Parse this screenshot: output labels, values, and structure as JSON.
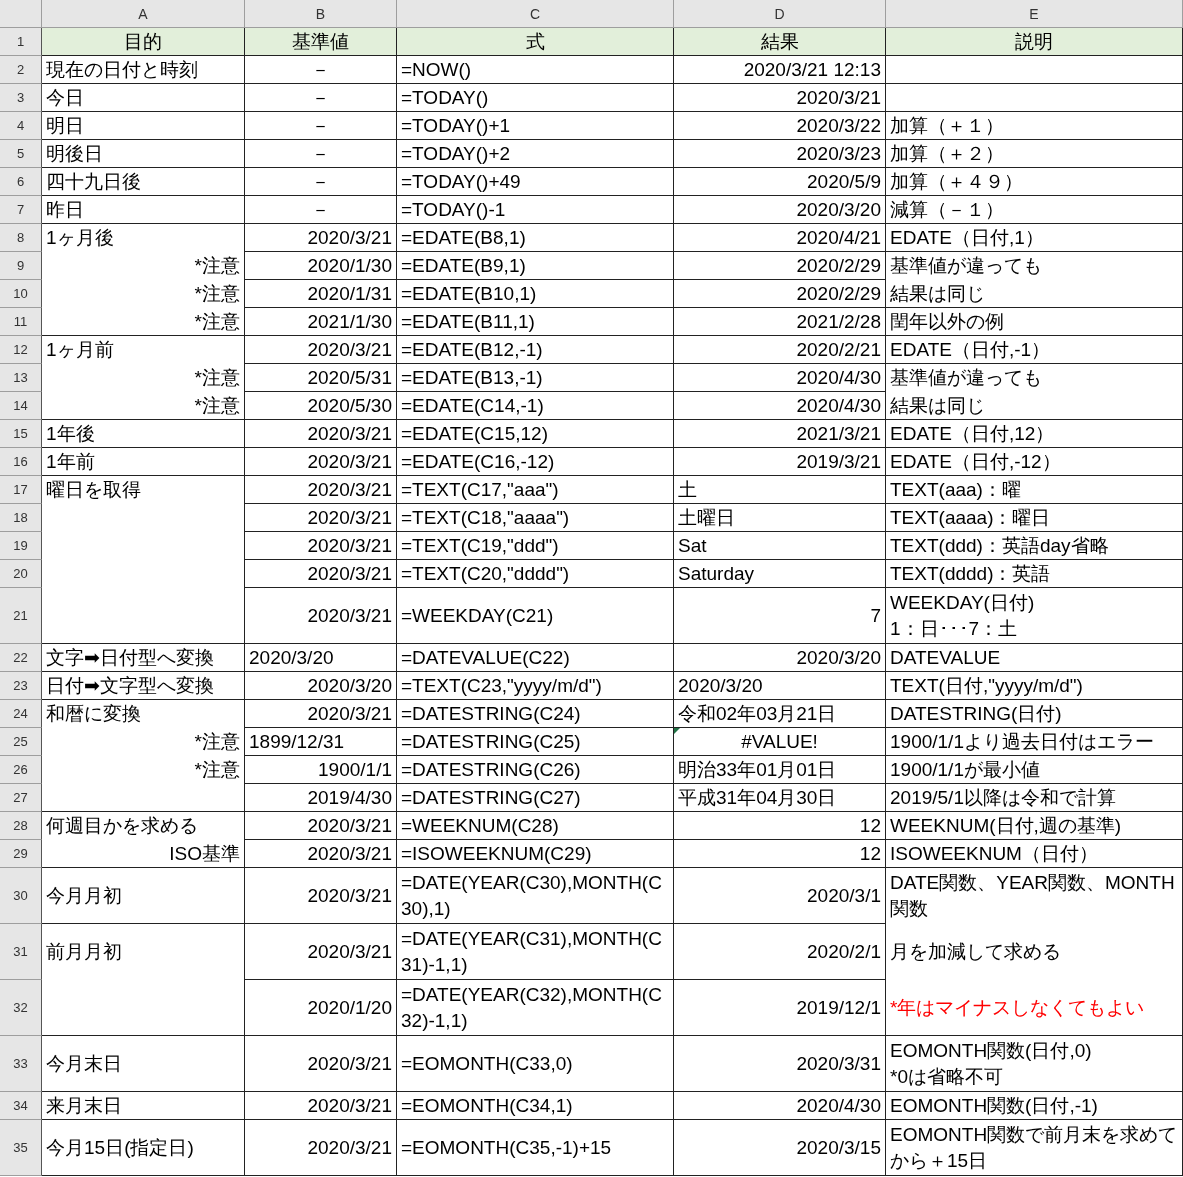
{
  "column_letters": [
    "A",
    "B",
    "C",
    "D",
    "E"
  ],
  "rows": [
    {
      "label": "1",
      "kind": "single"
    },
    {
      "label": "2",
      "kind": "single"
    },
    {
      "label": "3",
      "kind": "single"
    },
    {
      "label": "4",
      "kind": "single"
    },
    {
      "label": "5",
      "kind": "single"
    },
    {
      "label": "6",
      "kind": "single"
    },
    {
      "label": "7",
      "kind": "single"
    },
    {
      "label": "8",
      "kind": "single"
    },
    {
      "label": "9",
      "kind": "single"
    },
    {
      "label": "10",
      "kind": "single"
    },
    {
      "label": "11",
      "kind": "single"
    },
    {
      "label": "12",
      "kind": "single"
    },
    {
      "label": "13",
      "kind": "single"
    },
    {
      "label": "14",
      "kind": "single"
    },
    {
      "label": "15",
      "kind": "single"
    },
    {
      "label": "16",
      "kind": "single"
    },
    {
      "label": "17",
      "kind": "single"
    },
    {
      "label": "18",
      "kind": "single"
    },
    {
      "label": "19",
      "kind": "single"
    },
    {
      "label": "20",
      "kind": "single"
    },
    {
      "label": "21",
      "kind": "double"
    },
    {
      "label": "22",
      "kind": "single"
    },
    {
      "label": "23",
      "kind": "single"
    },
    {
      "label": "24",
      "kind": "single"
    },
    {
      "label": "25",
      "kind": "single"
    },
    {
      "label": "26",
      "kind": "single"
    },
    {
      "label": "27",
      "kind": "single"
    },
    {
      "label": "28",
      "kind": "single"
    },
    {
      "label": "29",
      "kind": "single"
    },
    {
      "label": "30",
      "kind": "double"
    },
    {
      "label": "31",
      "kind": "double"
    },
    {
      "label": "32",
      "kind": "double"
    },
    {
      "label": "33",
      "kind": "double"
    },
    {
      "label": "34",
      "kind": "single"
    },
    {
      "label": "35",
      "kind": "double"
    }
  ],
  "columns": [
    {
      "blocks": [
        {
          "kind": "header",
          "lines": [
            {
              "text": "目的",
              "kind": "center"
            }
          ]
        },
        {
          "lines": [
            {
              "text": "現在の日付と時刻",
              "kind": "left"
            }
          ]
        },
        {
          "lines": [
            {
              "text": "今日",
              "kind": "left"
            }
          ]
        },
        {
          "lines": [
            {
              "text": "明日",
              "kind": "left"
            }
          ]
        },
        {
          "lines": [
            {
              "text": "明後日",
              "kind": "left"
            }
          ]
        },
        {
          "lines": [
            {
              "text": "四十九日後",
              "kind": "left"
            }
          ]
        },
        {
          "lines": [
            {
              "text": "昨日",
              "kind": "left"
            }
          ]
        },
        {
          "lines": [
            {
              "text": "1ヶ月後",
              "kind": "left"
            },
            {
              "text": "*注意",
              "kind": "right"
            },
            {
              "text": "*注意",
              "kind": "right"
            },
            {
              "text": "*注意",
              "kind": "right"
            }
          ]
        },
        {
          "lines": [
            {
              "text": "1ヶ月前",
              "kind": "left"
            },
            {
              "text": "*注意",
              "kind": "right"
            },
            {
              "text": "*注意",
              "kind": "right"
            }
          ]
        },
        {
          "lines": [
            {
              "text": "1年後",
              "kind": "left"
            }
          ]
        },
        {
          "lines": [
            {
              "text": "1年前",
              "kind": "left"
            }
          ]
        },
        {
          "lines": [
            {
              "text": "曜日を取得",
              "kind": "left"
            },
            {
              "kind": "blank"
            },
            {
              "kind": "blank"
            },
            {
              "kind": "blank"
            },
            {
              "kind": "blank"
            }
          ]
        },
        {
          "lines": [
            {
              "text": "文字➡日付型へ変換",
              "kind": "left"
            }
          ]
        },
        {
          "lines": [
            {
              "text": "日付➡文字型へ変換",
              "kind": "left"
            }
          ]
        },
        {
          "lines": [
            {
              "text": "和暦に変換",
              "kind": "left"
            },
            {
              "text": "*注意",
              "kind": "right"
            },
            {
              "text": "*注意",
              "kind": "right"
            },
            {
              "kind": "blank"
            }
          ]
        },
        {
          "lines": [
            {
              "text": "何週目かを求める",
              "kind": "left"
            },
            {
              "text": "ISO基準",
              "kind": "right"
            }
          ]
        },
        {
          "lines": [
            {
              "text": "今月月初",
              "kind": "left"
            }
          ]
        },
        {
          "lines": [
            {
              "text": "前月月初",
              "kind": "left"
            },
            {
              "kind": "blank"
            }
          ]
        },
        {
          "lines": [
            {
              "text": "今月末日",
              "kind": "left"
            }
          ]
        },
        {
          "lines": [
            {
              "text": "来月末日",
              "kind": "left"
            }
          ]
        },
        {
          "lines": [
            {
              "text": "今月15日(指定日)",
              "kind": "left"
            }
          ]
        }
      ]
    },
    {
      "blocks": [
        {
          "kind": "header",
          "lines": [
            {
              "text": "基準値",
              "kind": "center"
            }
          ]
        },
        {
          "lines": [
            {
              "text": "－",
              "kind": "center"
            }
          ]
        },
        {
          "lines": [
            {
              "text": "－",
              "kind": "center"
            }
          ]
        },
        {
          "lines": [
            {
              "text": "－",
              "kind": "center"
            }
          ]
        },
        {
          "lines": [
            {
              "text": "－",
              "kind": "center"
            }
          ]
        },
        {
          "lines": [
            {
              "text": "－",
              "kind": "center"
            }
          ]
        },
        {
          "lines": [
            {
              "text": "－",
              "kind": "center"
            }
          ]
        },
        {
          "lines": [
            {
              "text": "2020/3/21",
              "kind": "right"
            }
          ]
        },
        {
          "lines": [
            {
              "text": "2020/1/30",
              "kind": "right"
            }
          ]
        },
        {
          "lines": [
            {
              "text": "2020/1/31",
              "kind": "right"
            }
          ]
        },
        {
          "lines": [
            {
              "text": "2021/1/30",
              "kind": "right"
            }
          ]
        },
        {
          "lines": [
            {
              "text": "2020/3/21",
              "kind": "right"
            }
          ]
        },
        {
          "lines": [
            {
              "text": "2020/5/31",
              "kind": "right"
            }
          ]
        },
        {
          "lines": [
            {
              "text": "2020/5/30",
              "kind": "right"
            }
          ]
        },
        {
          "lines": [
            {
              "text": "2020/3/21",
              "kind": "right"
            }
          ]
        },
        {
          "lines": [
            {
              "text": "2020/3/21",
              "kind": "right"
            }
          ]
        },
        {
          "lines": [
            {
              "text": "2020/3/21",
              "kind": "right"
            }
          ]
        },
        {
          "lines": [
            {
              "text": "2020/3/21",
              "kind": "right"
            }
          ]
        },
        {
          "lines": [
            {
              "text": "2020/3/21",
              "kind": "right"
            }
          ]
        },
        {
          "lines": [
            {
              "text": "2020/3/21",
              "kind": "right"
            }
          ]
        },
        {
          "lines": [
            {
              "text": "2020/3/21",
              "kind": "right"
            }
          ]
        },
        {
          "lines": [
            {
              "text": "2020/3/20",
              "kind": "left"
            }
          ]
        },
        {
          "lines": [
            {
              "text": "2020/3/20",
              "kind": "right"
            }
          ]
        },
        {
          "lines": [
            {
              "text": "2020/3/21",
              "kind": "right"
            }
          ]
        },
        {
          "lines": [
            {
              "text": "1899/12/31",
              "kind": "left"
            }
          ]
        },
        {
          "lines": [
            {
              "text": "1900/1/1",
              "kind": "right"
            }
          ]
        },
        {
          "lines": [
            {
              "text": "2019/4/30",
              "kind": "right"
            }
          ]
        },
        {
          "lines": [
            {
              "text": "2020/3/21",
              "kind": "right"
            }
          ]
        },
        {
          "lines": [
            {
              "text": "2020/3/21",
              "kind": "right"
            }
          ]
        },
        {
          "lines": [
            {
              "text": "2020/3/21",
              "kind": "right"
            }
          ]
        },
        {
          "lines": [
            {
              "text": "2020/3/21",
              "kind": "right"
            }
          ]
        },
        {
          "lines": [
            {
              "text": "2020/1/20",
              "kind": "right"
            }
          ]
        },
        {
          "lines": [
            {
              "text": "2020/3/21",
              "kind": "right"
            }
          ]
        },
        {
          "lines": [
            {
              "text": "2020/3/21",
              "kind": "right"
            }
          ]
        },
        {
          "lines": [
            {
              "text": "2020/3/21",
              "kind": "right"
            }
          ]
        }
      ]
    },
    {
      "blocks": [
        {
          "kind": "header",
          "lines": [
            {
              "text": "式",
              "kind": "center"
            }
          ]
        },
        {
          "lines": [
            {
              "text": "=NOW()",
              "kind": "left"
            }
          ]
        },
        {
          "lines": [
            {
              "text": "=TODAY()",
              "kind": "left"
            }
          ]
        },
        {
          "lines": [
            {
              "text": "=TODAY()+1",
              "kind": "left"
            }
          ]
        },
        {
          "lines": [
            {
              "text": "=TODAY()+2",
              "kind": "left"
            }
          ]
        },
        {
          "lines": [
            {
              "text": "=TODAY()+49",
              "kind": "left"
            }
          ]
        },
        {
          "lines": [
            {
              "text": "=TODAY()-1",
              "kind": "left"
            }
          ]
        },
        {
          "lines": [
            {
              "text": "=EDATE(B8,1)",
              "kind": "left"
            }
          ]
        },
        {
          "lines": [
            {
              "text": "=EDATE(B9,1)",
              "kind": "left"
            }
          ]
        },
        {
          "lines": [
            {
              "text": "=EDATE(B10,1)",
              "kind": "left"
            }
          ]
        },
        {
          "lines": [
            {
              "text": "=EDATE(B11,1)",
              "kind": "left"
            }
          ]
        },
        {
          "lines": [
            {
              "text": "=EDATE(B12,-1)",
              "kind": "left"
            }
          ]
        },
        {
          "lines": [
            {
              "text": "=EDATE(B13,-1)",
              "kind": "left"
            }
          ]
        },
        {
          "lines": [
            {
              "text": "=EDATE(C14,-1)",
              "kind": "left"
            }
          ]
        },
        {
          "lines": [
            {
              "text": "=EDATE(C15,12)",
              "kind": "left"
            }
          ]
        },
        {
          "lines": [
            {
              "text": "=EDATE(C16,-12)",
              "kind": "left"
            }
          ]
        },
        {
          "lines": [
            {
              "text": "=TEXT(C17,\"aaa\")",
              "kind": "left"
            }
          ]
        },
        {
          "lines": [
            {
              "text": "=TEXT(C18,\"aaaa\")",
              "kind": "left"
            }
          ]
        },
        {
          "lines": [
            {
              "text": "=TEXT(C19,\"ddd\")",
              "kind": "left"
            }
          ]
        },
        {
          "lines": [
            {
              "text": "=TEXT(C20,\"dddd\")",
              "kind": "left"
            }
          ]
        },
        {
          "lines": [
            {
              "text": "=WEEKDAY(C21)",
              "kind": "left"
            }
          ]
        },
        {
          "lines": [
            {
              "text": "=DATEVALUE(C22)",
              "kind": "left"
            }
          ]
        },
        {
          "lines": [
            {
              "text": "=TEXT(C23,\"yyyy/m/d\")",
              "kind": "left"
            }
          ]
        },
        {
          "lines": [
            {
              "text": "=DATESTRING(C24)",
              "kind": "left"
            }
          ]
        },
        {
          "lines": [
            {
              "text": "=DATESTRING(C25)",
              "kind": "left"
            }
          ]
        },
        {
          "lines": [
            {
              "text": "=DATESTRING(C26)",
              "kind": "left"
            }
          ]
        },
        {
          "lines": [
            {
              "text": "=DATESTRING(C27)",
              "kind": "left"
            }
          ]
        },
        {
          "lines": [
            {
              "text": "=WEEKNUM(C28)",
              "kind": "left"
            }
          ]
        },
        {
          "lines": [
            {
              "text": "=ISOWEEKNUM(C29)",
              "kind": "left"
            }
          ]
        },
        {
          "lines": [
            {
              "text": "=DATE(YEAR(C30),MONTH(C30),1)",
              "kind": "left"
            }
          ]
        },
        {
          "lines": [
            {
              "text": "=DATE(YEAR(C31),MONTH(C31)-1,1)",
              "kind": "left"
            }
          ]
        },
        {
          "lines": [
            {
              "text": "=DATE(YEAR(C32),MONTH(C32)-1,1)",
              "kind": "left"
            }
          ]
        },
        {
          "lines": [
            {
              "text": "=EOMONTH(C33,0)",
              "kind": "left"
            }
          ]
        },
        {
          "lines": [
            {
              "text": "=EOMONTH(C34,1)",
              "kind": "left"
            }
          ]
        },
        {
          "lines": [
            {
              "text": "=EOMONTH(C35,-1)+15",
              "kind": "left"
            }
          ]
        }
      ]
    },
    {
      "blocks": [
        {
          "kind": "header",
          "lines": [
            {
              "text": "結果",
              "kind": "center"
            }
          ]
        },
        {
          "lines": [
            {
              "text": "2020/3/21 12:13",
              "kind": "right"
            }
          ]
        },
        {
          "lines": [
            {
              "text": "2020/3/21",
              "kind": "right"
            }
          ]
        },
        {
          "lines": [
            {
              "text": "2020/3/22",
              "kind": "right"
            }
          ]
        },
        {
          "lines": [
            {
              "text": "2020/3/23",
              "kind": "right"
            }
          ]
        },
        {
          "lines": [
            {
              "text": "2020/5/9",
              "kind": "right"
            }
          ]
        },
        {
          "lines": [
            {
              "text": "2020/3/20",
              "kind": "right"
            }
          ]
        },
        {
          "lines": [
            {
              "text": "2020/4/21",
              "kind": "right"
            }
          ]
        },
        {
          "lines": [
            {
              "text": "2020/2/29",
              "kind": "right"
            }
          ]
        },
        {
          "lines": [
            {
              "text": "2020/2/29",
              "kind": "right"
            }
          ]
        },
        {
          "lines": [
            {
              "text": "2021/2/28",
              "kind": "right"
            }
          ]
        },
        {
          "lines": [
            {
              "text": "2020/2/21",
              "kind": "right"
            }
          ]
        },
        {
          "lines": [
            {
              "text": "2020/4/30",
              "kind": "right"
            }
          ]
        },
        {
          "lines": [
            {
              "text": "2020/4/30",
              "kind": "right"
            }
          ]
        },
        {
          "lines": [
            {
              "text": "2021/3/21",
              "kind": "right"
            }
          ]
        },
        {
          "lines": [
            {
              "text": "2019/3/21",
              "kind": "right"
            }
          ]
        },
        {
          "lines": [
            {
              "text": "土",
              "kind": "left"
            }
          ]
        },
        {
          "lines": [
            {
              "text": "土曜日",
              "kind": "left"
            }
          ]
        },
        {
          "lines": [
            {
              "text": "Sat",
              "kind": "left"
            }
          ]
        },
        {
          "lines": [
            {
              "text": "Saturday",
              "kind": "left"
            }
          ]
        },
        {
          "lines": [
            {
              "text": "7",
              "kind": "right"
            }
          ]
        },
        {
          "lines": [
            {
              "text": "2020/3/20",
              "kind": "right"
            }
          ]
        },
        {
          "lines": [
            {
              "text": "2020/3/20",
              "kind": "left"
            }
          ]
        },
        {
          "lines": [
            {
              "text": "令和02年03月21日",
              "kind": "left"
            }
          ]
        },
        {
          "lines": [
            {
              "text": "#VALUE!",
              "kind": "center",
              "error_flag": true
            }
          ]
        },
        {
          "lines": [
            {
              "text": "明治33年01月01日",
              "kind": "left"
            }
          ]
        },
        {
          "lines": [
            {
              "text": "平成31年04月30日",
              "kind": "left"
            }
          ]
        },
        {
          "lines": [
            {
              "text": "12",
              "kind": "right"
            }
          ]
        },
        {
          "lines": [
            {
              "text": "12",
              "kind": "right"
            }
          ]
        },
        {
          "lines": [
            {
              "text": "2020/3/1",
              "kind": "right"
            }
          ]
        },
        {
          "lines": [
            {
              "text": "2020/2/1",
              "kind": "right"
            }
          ]
        },
        {
          "lines": [
            {
              "text": "2019/12/1",
              "kind": "right"
            }
          ]
        },
        {
          "lines": [
            {
              "text": "2020/3/31",
              "kind": "right"
            }
          ]
        },
        {
          "lines": [
            {
              "text": "2020/4/30",
              "kind": "right"
            }
          ]
        },
        {
          "lines": [
            {
              "text": "2020/3/15",
              "kind": "right"
            }
          ]
        }
      ]
    },
    {
      "blocks": [
        {
          "kind": "header",
          "lines": [
            {
              "text": "説明",
              "kind": "center"
            }
          ]
        },
        {
          "lines": [
            {
              "kind": "blank"
            }
          ]
        },
        {
          "lines": [
            {
              "kind": "blank"
            }
          ]
        },
        {
          "lines": [
            {
              "text": "加算（＋１）",
              "kind": "left"
            }
          ]
        },
        {
          "lines": [
            {
              "text": "加算（＋２）",
              "kind": "left"
            }
          ]
        },
        {
          "lines": [
            {
              "text": "加算（＋４９）",
              "kind": "left"
            }
          ]
        },
        {
          "lines": [
            {
              "text": "減算（－１）",
              "kind": "left"
            }
          ]
        },
        {
          "lines": [
            {
              "text": "EDATE（日付,1）",
              "kind": "left"
            }
          ]
        },
        {
          "lines": [
            {
              "text": "基準値が違っても",
              "kind": "left"
            },
            {
              "text": "結果は同じ",
              "kind": "left"
            }
          ]
        },
        {
          "lines": [
            {
              "text": "閏年以外の例",
              "kind": "left"
            }
          ]
        },
        {
          "lines": [
            {
              "text": "EDATE（日付,-1）",
              "kind": "left"
            }
          ]
        },
        {
          "lines": [
            {
              "text": "基準値が違っても",
              "kind": "left"
            },
            {
              "text": "結果は同じ",
              "kind": "left"
            }
          ]
        },
        {
          "lines": [
            {
              "text": "EDATE（日付,12）",
              "kind": "left"
            }
          ]
        },
        {
          "lines": [
            {
              "text": "EDATE（日付,-12）",
              "kind": "left"
            }
          ]
        },
        {
          "lines": [
            {
              "text": "TEXT(aaa)：曜",
              "kind": "left"
            }
          ]
        },
        {
          "lines": [
            {
              "text": "TEXT(aaaa)：曜日",
              "kind": "left"
            }
          ]
        },
        {
          "lines": [
            {
              "text": "TEXT(ddd)：英語day省略",
              "kind": "left"
            }
          ]
        },
        {
          "lines": [
            {
              "text": "TEXT(dddd)：英語",
              "kind": "left"
            }
          ]
        },
        {
          "lines": [
            {
              "text": "WEEKDAY(日付)\n1：日･･･7：土",
              "kind": "left"
            }
          ]
        },
        {
          "lines": [
            {
              "text": "DATEVALUE",
              "kind": "left"
            }
          ]
        },
        {
          "lines": [
            {
              "text": "TEXT(日付,\"yyyy/m/d\")",
              "kind": "left"
            }
          ]
        },
        {
          "lines": [
            {
              "text": "DATESTRING(日付)",
              "kind": "left"
            }
          ]
        },
        {
          "lines": [
            {
              "text": "1900/1/1より過去日付はエラー",
              "kind": "left"
            }
          ]
        },
        {
          "lines": [
            {
              "text": "1900/1/1が最小値",
              "kind": "left"
            }
          ]
        },
        {
          "lines": [
            {
              "text": "2019/5/1以降は令和で計算",
              "kind": "left"
            }
          ]
        },
        {
          "lines": [
            {
              "text": "WEEKNUM(日付,週の基準)",
              "kind": "left"
            }
          ]
        },
        {
          "lines": [
            {
              "text": "ISOWEEKNUM（日付）",
              "kind": "left"
            }
          ]
        },
        {
          "lines": [
            {
              "text": "DATE関数、YEAR関数、MONTH関数",
              "kind": "left"
            },
            {
              "text": "月を加減して求める",
              "kind": "left"
            },
            {
              "text": "*年はマイナスしなくてもよい",
              "kind": "left",
              "color": "#ff0000"
            }
          ]
        },
        {
          "lines": [
            {
              "text": "EOMONTH関数(日付,0)\n*0は省略不可",
              "kind": "left"
            }
          ]
        },
        {
          "lines": [
            {
              "text": "EOMONTH関数(日付,-1)",
              "kind": "left"
            }
          ]
        },
        {
          "lines": [
            {
              "text": "EOMONTH関数で前月末を求めてから＋15日",
              "kind": "left"
            }
          ]
        }
      ]
    }
  ]
}
